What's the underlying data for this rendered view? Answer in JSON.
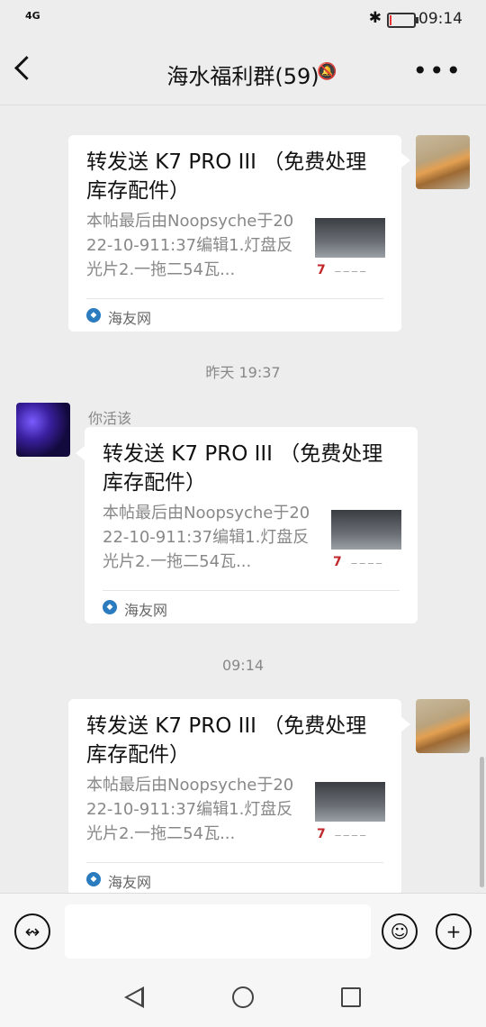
{
  "status": {
    "network": "4G",
    "time": "09:14",
    "battery_level": 0.1,
    "bluetooth_icon": "bluetooth-icon"
  },
  "header": {
    "title": "海水福利群(59)",
    "back_icon": "back-arrow-icon",
    "mute_icon": "bell-muted-icon",
    "more_icon": "more-icon"
  },
  "messages": [
    {
      "timestamp": "",
      "side": "right",
      "sender": "",
      "card": {
        "title": "转发送 K7 PRO III （免费处理库存配件）",
        "desc": "本帖最后由Noopsyche于2022-10-911:37编辑1.灯盘反光片2.一拖二54瓦...",
        "source": "海友网"
      }
    },
    {
      "timestamp": "昨天 19:37",
      "side": "left",
      "sender": "你活该",
      "card": {
        "title": "转发送 K7 PRO III （免费处理库存配件）",
        "desc": "本帖最后由Noopsyche于2022-10-911:37编辑1.灯盘反光片2.一拖二54瓦...",
        "source": "海友网"
      }
    },
    {
      "timestamp": "09:14",
      "side": "right",
      "sender": "",
      "card": {
        "title": "转发送 K7 PRO III （免费处理库存配件）",
        "desc": "本帖最后由Noopsyche于2022-10-911:37编辑1.灯盘反光片2.一拖二54瓦...",
        "source": "海友网"
      }
    }
  ],
  "thumb": {
    "badge": "7"
  },
  "input": {
    "voice_icon": "voice-icon",
    "emoji_icon": "emoji-icon",
    "plus_icon": "plus-icon",
    "value": ""
  },
  "nav": {
    "back": "nav-back-icon",
    "home": "nav-home-icon",
    "recent": "nav-recent-icon"
  }
}
